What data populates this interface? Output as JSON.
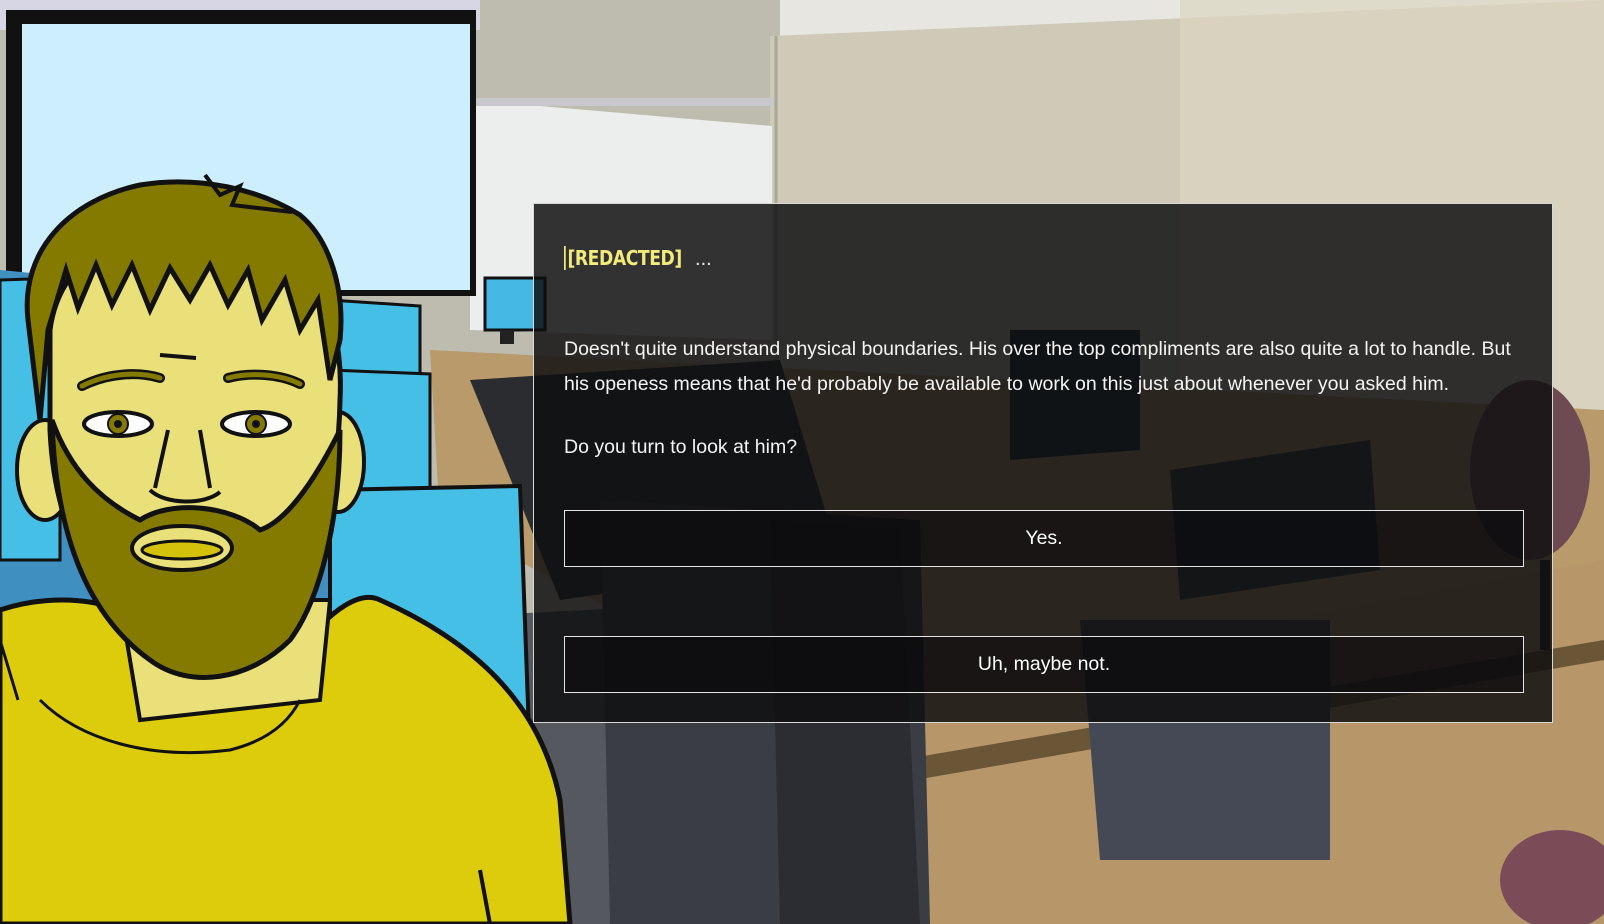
{
  "dialog": {
    "speaker": "[REDACTED]",
    "speaker_trail": "...",
    "body": "Doesn't quite understand physical boundaries. His over the top compliments are also quite a lot to handle. But his openess means that he'd probably be available to work on this just about whenever you asked him.",
    "question": "Do you turn to look at him?",
    "choices": [
      {
        "label": "Yes."
      },
      {
        "label": "Uh, maybe not."
      }
    ]
  },
  "colors": {
    "speaker": "#f2ea7a",
    "panel": "#0e0e10",
    "shirt": "#ddcc0c",
    "hair": "#857a00",
    "skin": "#e9e07a"
  },
  "scene": {
    "background": "computer-lab",
    "character": "bearded-man-yellow-shirt"
  }
}
